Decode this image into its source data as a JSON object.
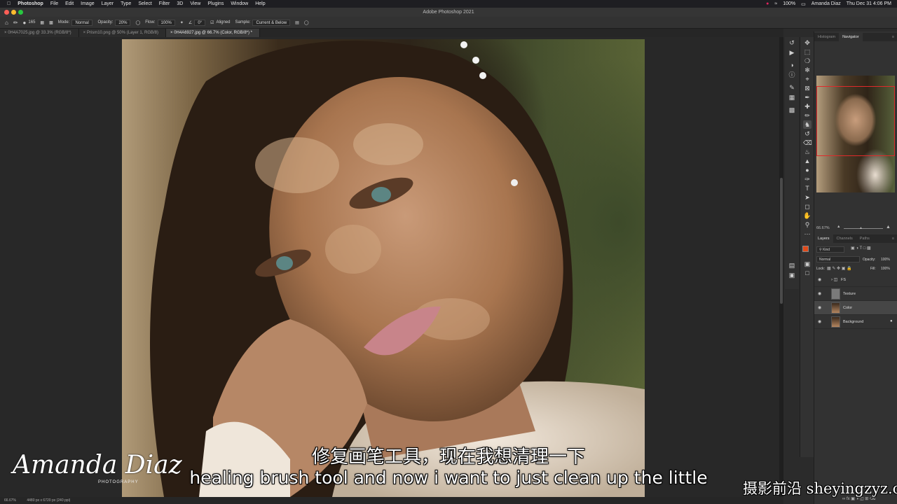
{
  "menubar": {
    "app_name": "Photoshop",
    "items": [
      "File",
      "Edit",
      "Image",
      "Layer",
      "Type",
      "Select",
      "Filter",
      "3D",
      "View",
      "Plugins",
      "Window",
      "Help"
    ],
    "battery": "100%",
    "user": "Amanda Diaz",
    "clock": "Thu Dec 31  4:06 PM"
  },
  "window": {
    "title": "Adobe Photoshop 2021"
  },
  "options": {
    "brush_size": "165",
    "mode_label": "Mode:",
    "mode_value": "Normal",
    "opacity_label": "Opacity:",
    "opacity_value": "20%",
    "flow_label": "Flow:",
    "flow_value": "100%",
    "angle_value": "0°",
    "aligned_label": "Aligned",
    "sample_label": "Sample:",
    "sample_value": "Current & Below"
  },
  "tabs": [
    {
      "label": "0H4A7025.jpg @ 33.3% (RGB/8*)"
    },
    {
      "label": "Prism10.png @ 50% (Layer 1, RGB/8)"
    },
    {
      "label": "0H4A6927.jpg @ 66.7% (Color, RGB/8*) *"
    }
  ],
  "status": {
    "zoom": "66.67%",
    "doc_info": "4480 px x 6720 px (240 ppi)"
  },
  "panels": {
    "top_tabs": [
      "Histogram",
      "Navigator"
    ],
    "navigator_zoom": "66.67%",
    "layer_tabs": [
      "Layers",
      "Channels",
      "Paths"
    ],
    "kind_label": "Kind",
    "blend_mode": "Normal",
    "opacity_label": "Opacity:",
    "opacity_value": "100%",
    "lock_label": "Lock:",
    "fill_label": "Fill:",
    "fill_value": "100%",
    "layers": [
      {
        "name": "FS"
      },
      {
        "name": "Texture"
      },
      {
        "name": "Color"
      },
      {
        "name": "Background"
      }
    ]
  },
  "overlay": {
    "subtitle_cn": "修复画笔工具，现在我想清理一下",
    "subtitle_en": "healing brush tool and now i want to just clean up the little",
    "signature": "Amanda Diaz",
    "signature_sub": "PHOTOGRAPHY",
    "watermark": "摄影前沿 sheyingzyz.com"
  },
  "colors": {
    "foreground": "#e04a1a",
    "background": "#ffffff",
    "nav_box": "#e02a2a"
  }
}
